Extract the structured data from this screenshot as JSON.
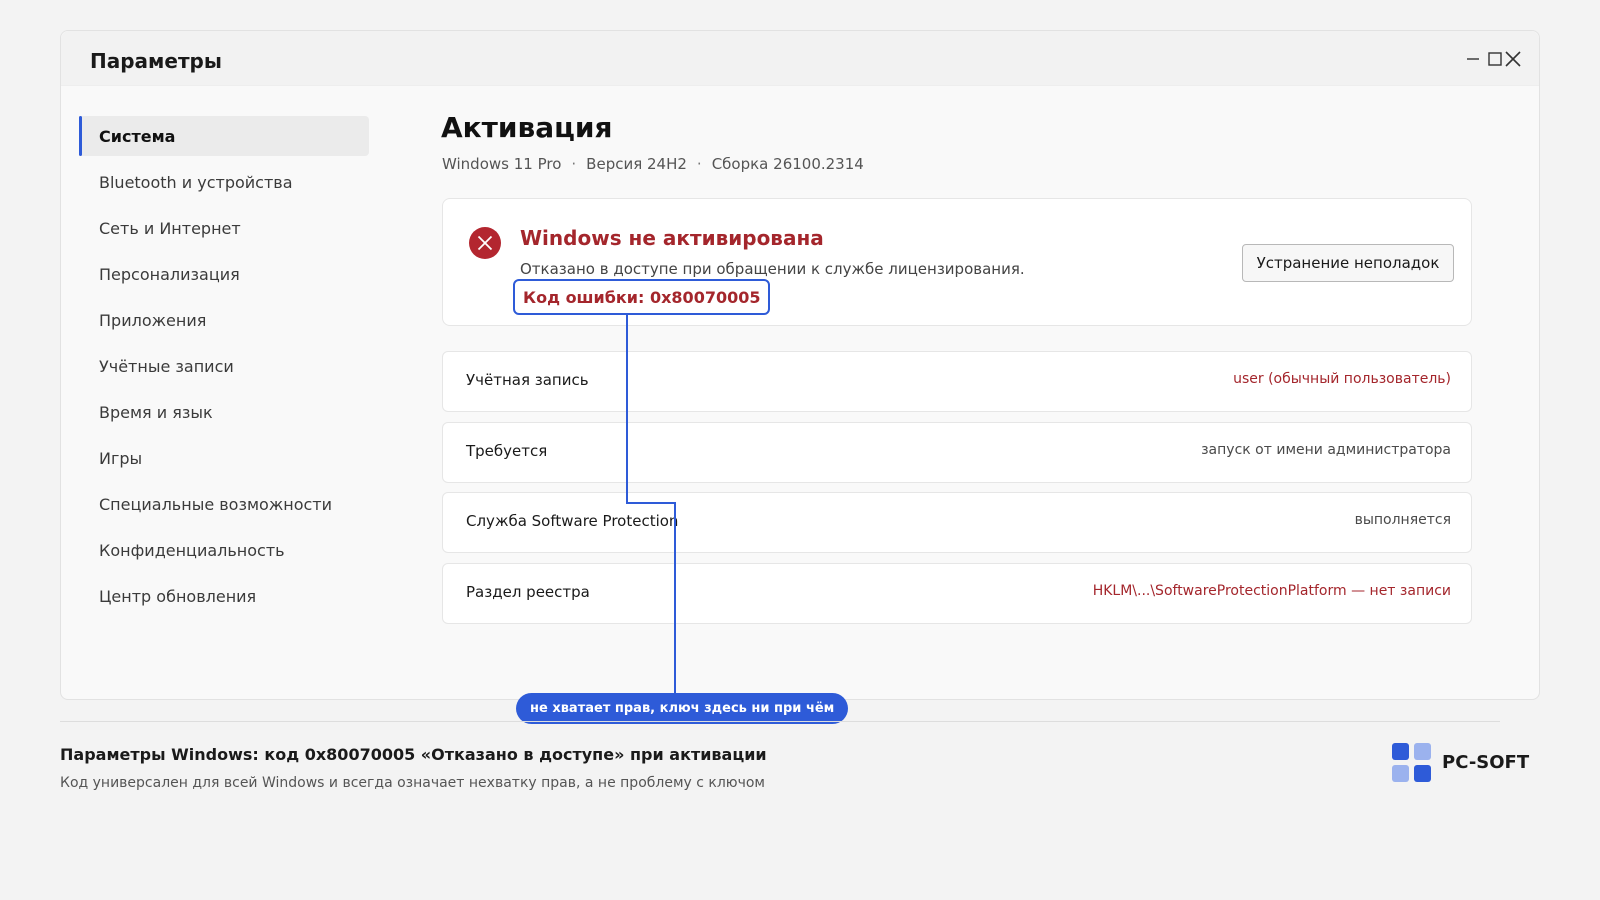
{
  "window": {
    "title": "Параметры"
  },
  "sidebar": {
    "items": [
      {
        "label": "Система",
        "active": true
      },
      {
        "label": "Bluetooth и устройства"
      },
      {
        "label": "Сеть и Интернет"
      },
      {
        "label": "Персонализация"
      },
      {
        "label": "Приложения"
      },
      {
        "label": "Учётные записи"
      },
      {
        "label": "Время и язык"
      },
      {
        "label": "Игры"
      },
      {
        "label": "Специальные возможности"
      },
      {
        "label": "Конфиденциальность"
      },
      {
        "label": "Центр обновления"
      }
    ]
  },
  "main": {
    "title": "Активация",
    "edition": "Windows 11 Pro",
    "version": "Версия 24H2",
    "build": "Сборка 26100.2314",
    "status": {
      "icon": "error-icon",
      "title": "Windows не активирована",
      "description": "Отказано в доступе при обращении к службе лицензирования.",
      "error_code": "Код ошибки: 0x80070005",
      "button": "Устранение неполадок"
    },
    "rows": [
      {
        "label": "Учётная запись",
        "value": "user (обычный пользователь)",
        "tone": "error"
      },
      {
        "label": "Требуется",
        "value": "запуск от имени администратора",
        "tone": "neutral"
      },
      {
        "label": "Служба Software Protection",
        "value": "выполняется",
        "tone": "neutral"
      },
      {
        "label": "Раздел реестра",
        "value": "HKLM\\...\\SoftwareProtectionPlatform — нет записи",
        "tone": "error"
      }
    ]
  },
  "callout": {
    "text": "не хватает прав, ключ здесь ни при чём"
  },
  "footer": {
    "title": "Параметры Windows: код 0x80070005 «Отказано в доступе» при активации",
    "subtitle": "Код универсален для всей Windows и всегда означает нехватку прав, а не проблему с ключом",
    "brand": "PC-SOFT"
  },
  "colors": {
    "accent": "#2e5bd8",
    "error": "#a4262c"
  }
}
